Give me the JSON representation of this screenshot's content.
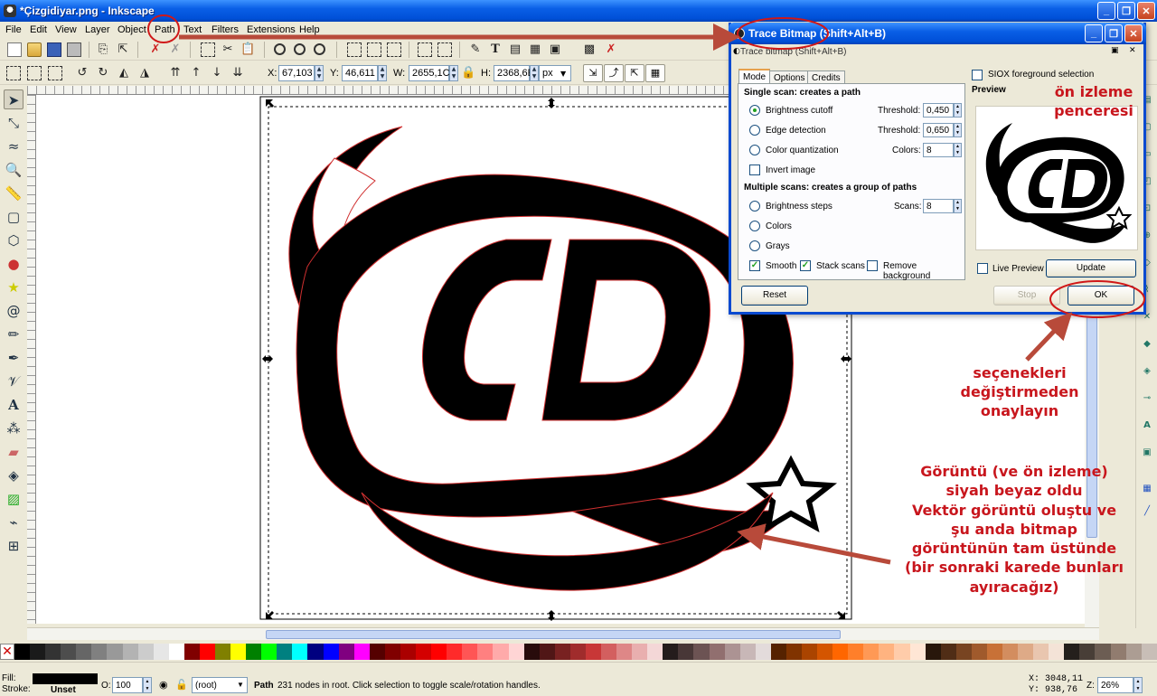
{
  "window": {
    "title": "*Çizgidiyar.png - Inkscape"
  },
  "menu": [
    "File",
    "Edit",
    "View",
    "Layer",
    "Object",
    "Path",
    "Text",
    "Filters",
    "Extensions",
    "Help"
  ],
  "controls": {
    "x_label": "X:",
    "x_value": "67,103",
    "y_label": "Y:",
    "y_value": "46,611",
    "w_label": "W:",
    "w_value": "2655,1C",
    "h_label": "H:",
    "h_value": "2368,6E",
    "unit": "px"
  },
  "dialog": {
    "title": "Trace Bitmap (Shift+Alt+B)",
    "subtitle": "Trace bitmap (Shift+Alt+B)",
    "tabs": [
      "Mode",
      "Options",
      "Credits"
    ],
    "single_scan_header": "Single scan: creates a path",
    "brightness_cutoff": "Brightness cutoff",
    "edge_detection": "Edge detection",
    "color_quantization": "Color quantization",
    "invert_image": "Invert image",
    "threshold_label": "Threshold:",
    "threshold_1": "0,450",
    "threshold_2": "0,650",
    "colors_label": "Colors:",
    "colors_value": "8",
    "multi_scan_header": "Multiple scans: creates a group of paths",
    "brightness_steps": "Brightness steps",
    "scans_label": "Scans:",
    "scans_value": "8",
    "colors_option": "Colors",
    "grays_option": "Grays",
    "smooth": "Smooth",
    "stack_scans": "Stack scans",
    "remove_background": "Remove background",
    "siox": "SIOX foreground selection",
    "preview_label": "Preview",
    "live_preview": "Live Preview",
    "update": "Update",
    "reset": "Reset",
    "stop": "Stop",
    "ok": "OK"
  },
  "annotations": {
    "preview_window": [
      "ön izleme",
      "penceresi"
    ],
    "confirm": [
      "seçenekleri",
      "değiştirmeden",
      "onaylayın"
    ],
    "result": [
      "Görüntü (ve ön izleme)",
      "siyah beyaz oldu",
      "Vektör görüntü oluştu ve",
      "şu anda bitmap",
      "görüntünün tam üstünde",
      "(bir sonraki karede bunları",
      "ayıracağız)"
    ]
  },
  "status": {
    "fill_label": "Fill:",
    "stroke_label": "Stroke:",
    "stroke_value": "Unset",
    "opacity_label": "O:",
    "opacity_value": "100",
    "layer": "(root)",
    "message_type": "Path",
    "message": "231 nodes in root. Click selection to toggle scale/rotation handles.",
    "cursor_x": "X: 3048,11",
    "cursor_y": "Y:  938,76",
    "zoom_label": "Z:",
    "zoom_value": "26%"
  },
  "palette_colors": [
    "#000000",
    "#1a1a1a",
    "#333333",
    "#4d4d4d",
    "#666666",
    "#808080",
    "#999999",
    "#b3b3b3",
    "#cccccc",
    "#e6e6e6",
    "#ffffff",
    "#800000",
    "#ff0000",
    "#808000",
    "#ffff00",
    "#008000",
    "#00ff00",
    "#008080",
    "#00ffff",
    "#000080",
    "#0000ff",
    "#800080",
    "#ff00ff",
    "#550000",
    "#800000",
    "#aa0000",
    "#d40000",
    "#ff0000",
    "#ff2a2a",
    "#ff5555",
    "#ff8080",
    "#ffaaaa",
    "#ffd5d5",
    "#280b0b",
    "#501616",
    "#782121",
    "#a02c2c",
    "#c83737",
    "#d35f5f",
    "#de8787",
    "#e9afaf",
    "#f4d7d7",
    "#241c1c",
    "#483737",
    "#6c5353",
    "#916f6f",
    "#ac9393",
    "#c8b7b7",
    "#e3dbdb",
    "#552200",
    "#803300",
    "#aa4400",
    "#d45500",
    "#ff6600",
    "#ff7f2a",
    "#ff9955",
    "#ffb380",
    "#ffccaa",
    "#ffe6d5",
    "#28170b",
    "#502d16",
    "#784421",
    "#a05a2c",
    "#c87137",
    "#d38d5f",
    "#deaa87",
    "#e9c6af",
    "#f4e3d7",
    "#241f1c",
    "#483e37",
    "#6c5d53",
    "#917c6f",
    "#ac9d93",
    "#c8beb7"
  ]
}
